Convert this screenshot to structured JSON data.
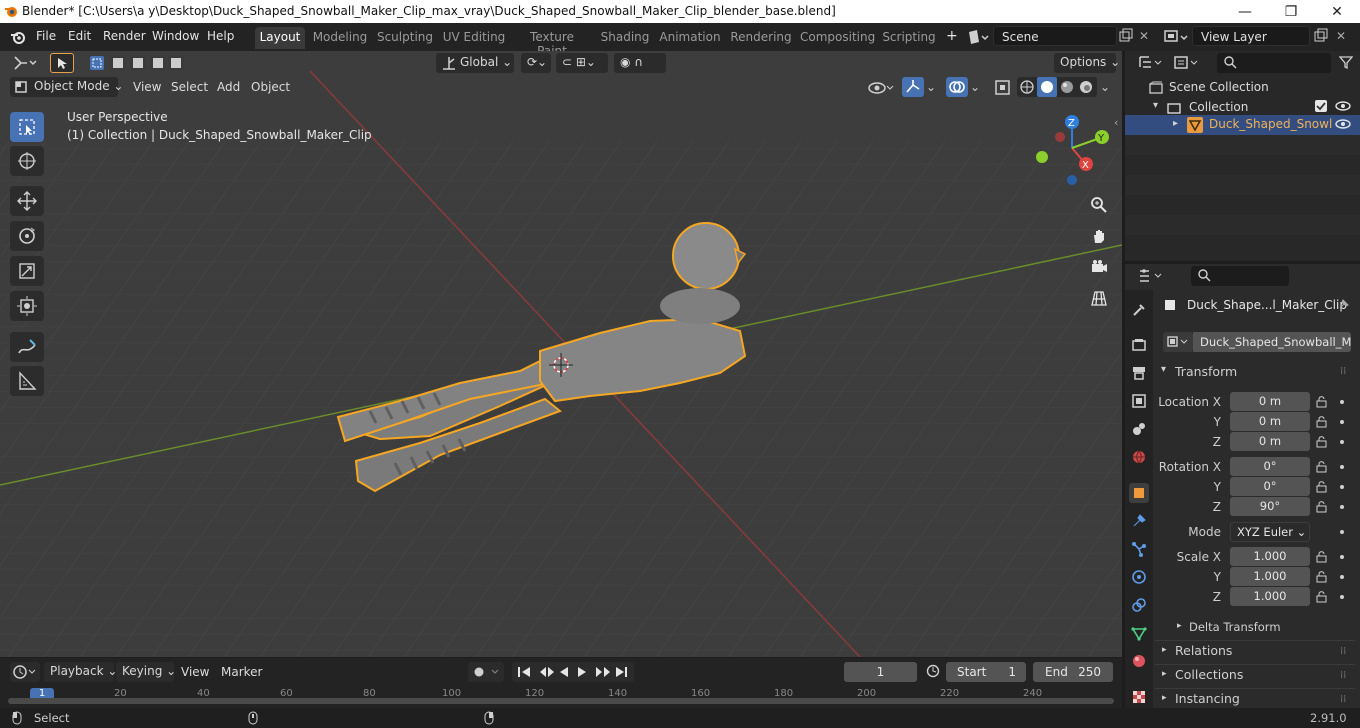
{
  "titlebar": {
    "title": "Blender* [C:\\Users\\a y\\Desktop\\Duck_Shaped_Snowball_Maker_Clip_max_vray\\Duck_Shaped_Snowball_Maker_Clip_blender_base.blend]",
    "min": "—",
    "max": "❐",
    "close": "✕"
  },
  "menu": {
    "file": "File",
    "edit": "Edit",
    "render": "Render",
    "window": "Window",
    "help": "Help"
  },
  "workspaces": [
    "Layout",
    "Modeling",
    "Sculpting",
    "UV Editing",
    "Texture Paint",
    "Shading",
    "Animation",
    "Rendering",
    "Compositing",
    "Scripting"
  ],
  "scene": {
    "name": "Scene",
    "view_layer": "View Layer"
  },
  "viewport_header": {
    "transform_orientation": "Global",
    "options": "Options",
    "mode": "Object Mode",
    "view": "View",
    "select": "Select",
    "add": "Add",
    "object": "Object"
  },
  "viewport": {
    "perspective": "User Perspective",
    "collection_info": "(1) Collection | Duck_Shaped_Snowball_Maker_Clip",
    "gizmo": {
      "x": "X",
      "y": "Y",
      "z": "Z"
    }
  },
  "outliner": {
    "scene_collection": "Scene Collection",
    "collection": "Collection",
    "object": "Duck_Shaped_Snowl"
  },
  "properties": {
    "object_name": "Duck_Shape...l_Maker_Clip",
    "mesh_name": "Duck_Shaped_Snowball_Ma...",
    "transform_title": "Transform",
    "location_label": "Location X",
    "location": {
      "x": "0 m",
      "y": "0 m",
      "z": "0 m"
    },
    "rotation_label": "Rotation X",
    "rotation": {
      "x": "0°",
      "y": "0°",
      "z": "90°"
    },
    "mode_label": "Mode",
    "mode": "XYZ Euler",
    "scale_label": "Scale X",
    "scale": {
      "x": "1.000",
      "y": "1.000",
      "z": "1.000"
    },
    "y_label": "Y",
    "z_label": "Z",
    "delta_transform": "Delta Transform",
    "relations": "Relations",
    "collections": "Collections",
    "instancing": "Instancing"
  },
  "timeline": {
    "playback": "Playback",
    "keying": "Keying",
    "view": "View",
    "marker": "Marker",
    "current_frame": "1",
    "start_label": "Start",
    "start": "1",
    "end_label": "End",
    "end": "250",
    "ticks": [
      "1",
      "20",
      "40",
      "60",
      "80",
      "100",
      "120",
      "140",
      "160",
      "180",
      "200",
      "220",
      "240"
    ]
  },
  "statusbar": {
    "select": "Select",
    "version": "2.91.0"
  },
  "colors": {
    "accent": "#4772b3",
    "selection_outline": "#f5a623",
    "axis_x": "#e0443e",
    "axis_y": "#8ccf2c",
    "axis_z": "#2f7fe0"
  }
}
